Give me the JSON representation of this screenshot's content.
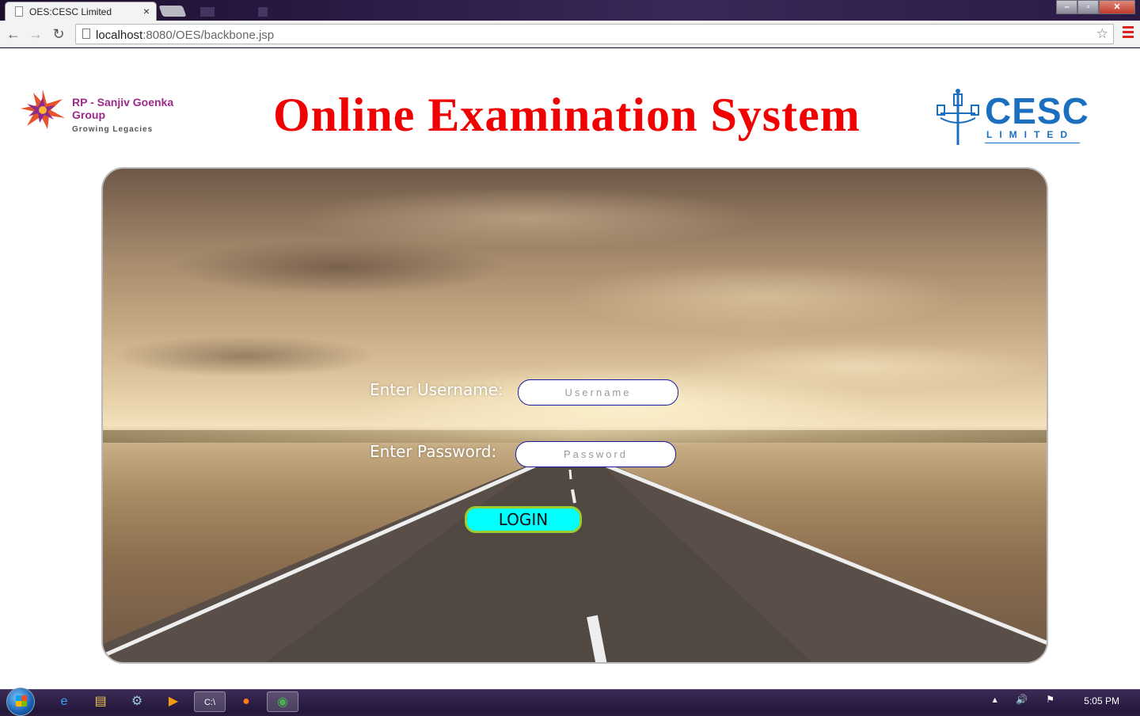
{
  "browser": {
    "tab_title": "OES:CESC Limited",
    "tab_close": "×",
    "url_host": "localhost",
    "url_rest": ":8080/OES/backbone.jsp",
    "back": "←",
    "forward": "→",
    "reload": "↻",
    "window_controls": [
      "–",
      "▫",
      "✕"
    ]
  },
  "header": {
    "left_logo_name": "RP - Sanjiv Goenka Group",
    "left_logo_tagline": "Growing Legacies",
    "title": "Online Examination System",
    "right_logo_name": "CESC",
    "right_logo_sub": "LIMITED"
  },
  "login": {
    "username_label": "Enter Username:",
    "username_placeholder": "Username",
    "password_label": "Enter Password:",
    "password_placeholder": "Password",
    "button": "LOGIN"
  },
  "taskbar": {
    "clock": "5:05 PM"
  },
  "colors": {
    "title_red": "#f00000",
    "login_bg": "#00ffff",
    "login_border": "#9acd32",
    "cesc_blue": "#1a6fc0"
  }
}
